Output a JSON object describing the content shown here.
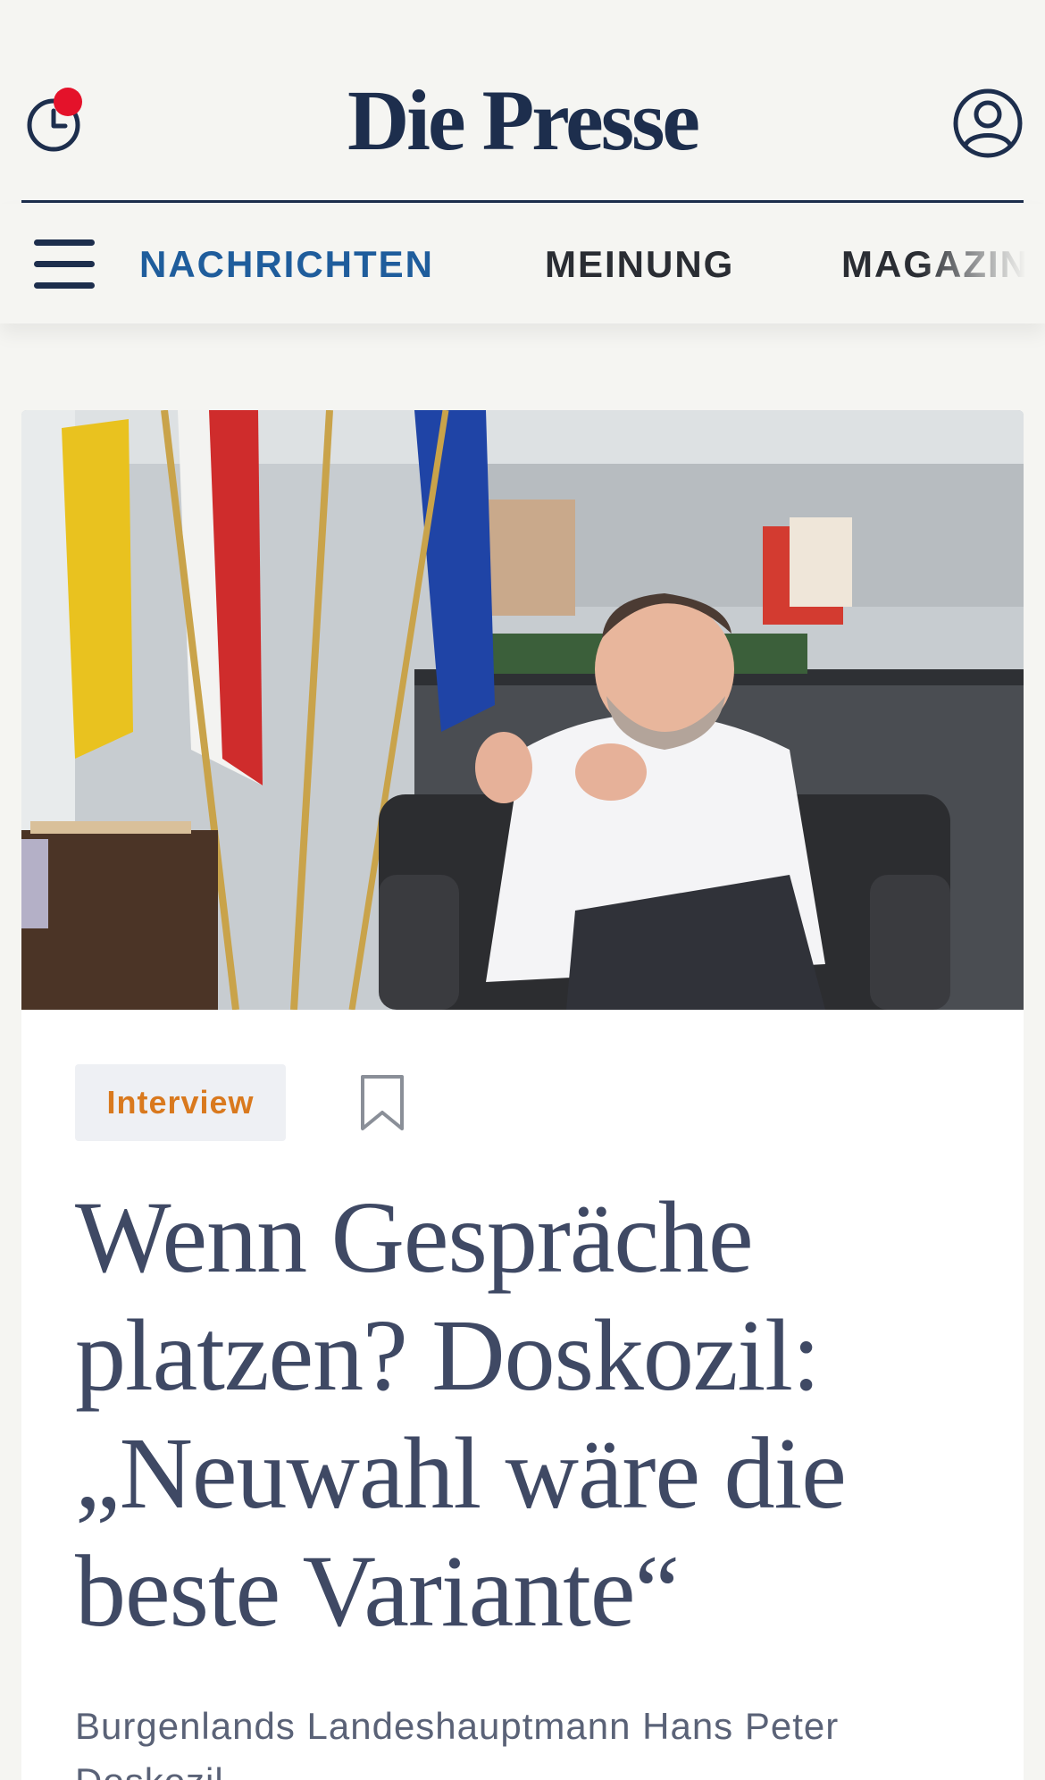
{
  "header": {
    "logo_text": "Die Presse",
    "notification_dot_color": "#e4122a",
    "brand_color": "#1d2e4d",
    "icons": {
      "history": "history-clock-icon",
      "account": "account-user-icon"
    }
  },
  "nav": {
    "items": [
      {
        "label": "NACHRICHTEN",
        "active": true
      },
      {
        "label": "MEINUNG",
        "active": false
      },
      {
        "label": "MAGAZIN",
        "active": false
      }
    ],
    "active_color": "#1f5d9c",
    "menu_icon": "hamburger-menu-icon"
  },
  "article": {
    "tag": "Interview",
    "tag_color": "#d9791e",
    "bookmark_icon": "bookmark-icon",
    "headline": "Wenn Gespräche platzen? Doskozil: „Neuwahl wäre die beste Variante“",
    "lead": "Burgenlands Landeshauptmann Hans Peter Doskozil"
  }
}
